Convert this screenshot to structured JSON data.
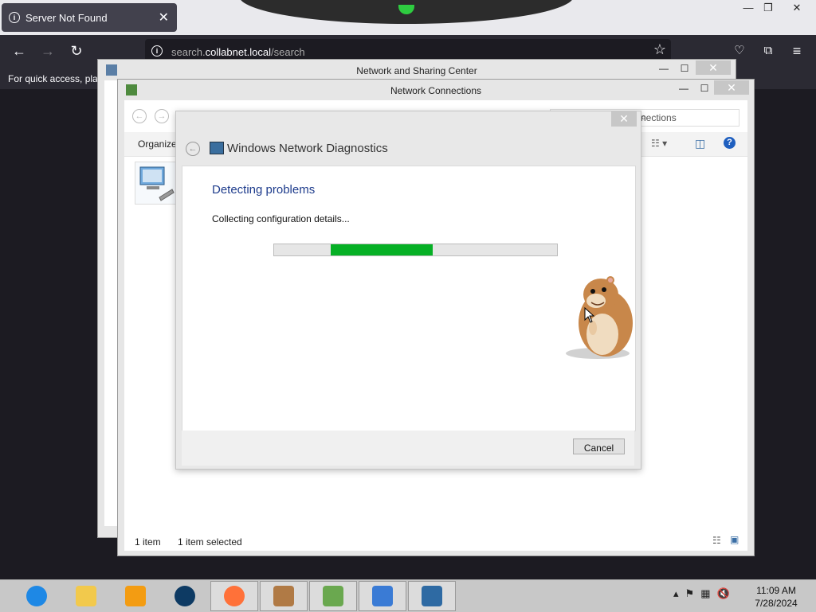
{
  "browser": {
    "tab_title": "Server Not Found",
    "url_domain": "search.",
    "url_host": "collabnet.local",
    "url_path": "/search",
    "bookmarks_hint": "For quick access, plac"
  },
  "network_sharing_center": {
    "title": "Network and Sharing Center"
  },
  "network_connections": {
    "title": "Network Connections",
    "search_placeholder": "nections",
    "organize_label": "Organize",
    "status_items": "1 item",
    "status_selected": "1 item selected"
  },
  "diagnostics": {
    "title": "Windows Network Diagnostics",
    "heading": "Detecting problems",
    "status": "Collecting configuration details...",
    "progress_segment": {
      "start": 0.2,
      "end": 0.56
    },
    "cancel_label": "Cancel"
  },
  "taskbar": {
    "time": "11:09 AM",
    "date": "7/28/2024",
    "items": [
      {
        "name": "internet-explorer-icon",
        "color": "#1e88e5"
      },
      {
        "name": "file-explorer-icon",
        "color": "#f2c94c"
      },
      {
        "name": "media-player-icon",
        "color": "#f39c12"
      },
      {
        "name": "globe-icon",
        "color": "#0d3a63"
      },
      {
        "name": "firefox-icon",
        "color": "#ff7139"
      },
      {
        "name": "hamster-icon",
        "color": "#b07a45"
      },
      {
        "name": "people-icon",
        "color": "#6aa84f"
      },
      {
        "name": "control-panel-icon",
        "color": "#3a7bd5"
      },
      {
        "name": "network-diagnostics-icon",
        "color": "#2e6aa3"
      }
    ]
  },
  "colors": {
    "accent_progress": "#06b025",
    "heading_blue": "#1e3c8c"
  }
}
